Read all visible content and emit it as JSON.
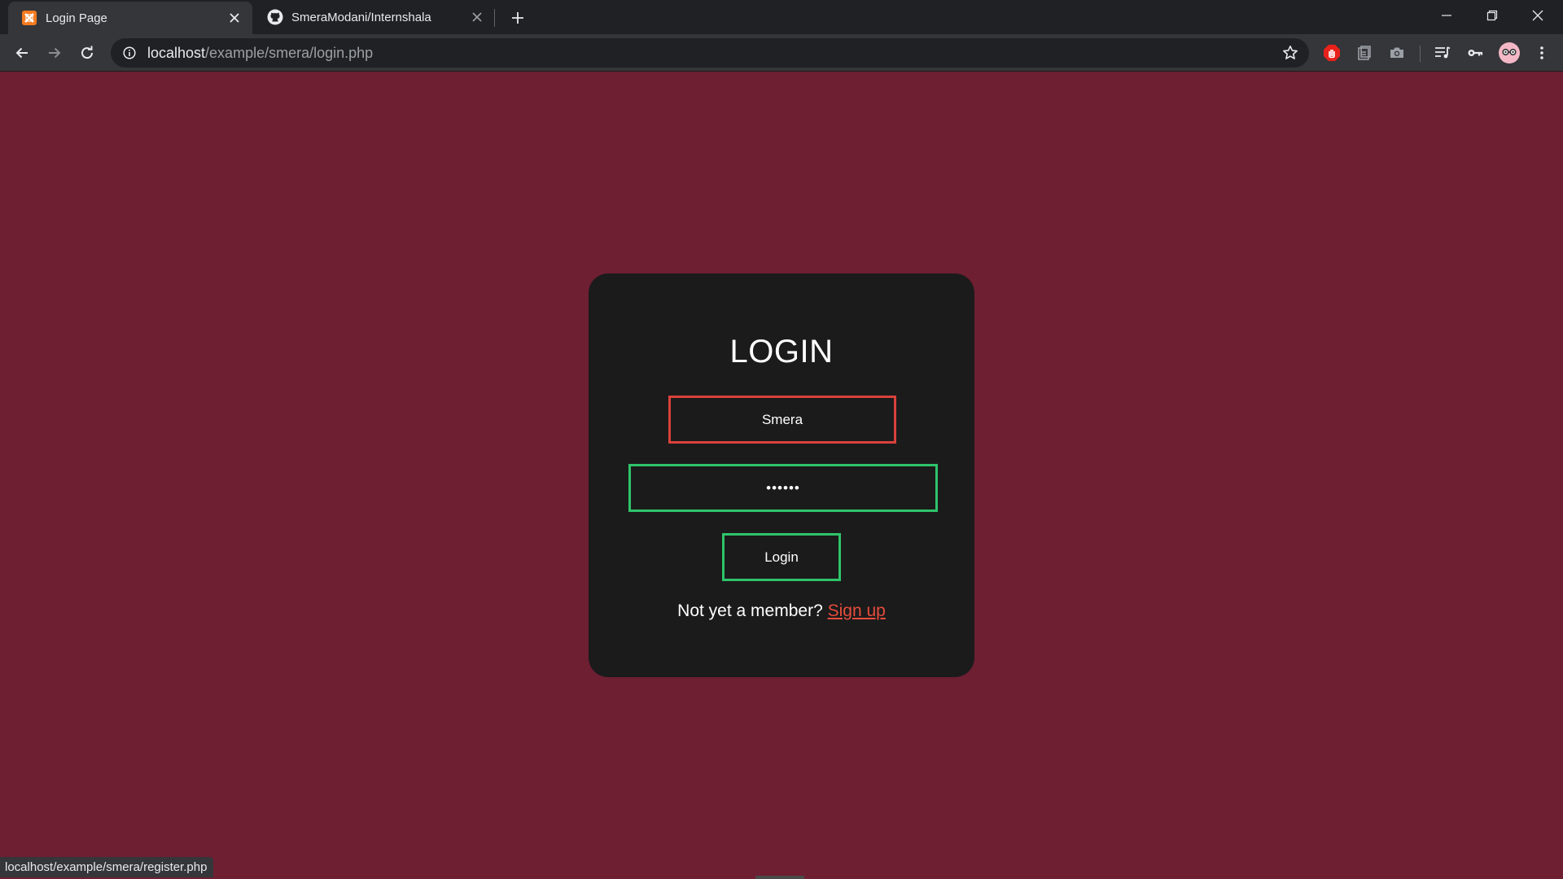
{
  "browser": {
    "tabs": [
      {
        "title": "Login Page",
        "icon": "xampp-icon",
        "active": true
      },
      {
        "title": "SmeraModani/Internshala",
        "icon": "github-icon",
        "active": false
      }
    ],
    "url_host": "localhost",
    "url_path": "/example/smera/login.php",
    "status_url": "localhost/example/smera/register.php",
    "extensions": [
      "adblock-icon",
      "clipboard-icon",
      "camera-icon",
      "media-queue-icon",
      "key-icon",
      "profile-avatar"
    ]
  },
  "login": {
    "title": "LOGIN",
    "username_value": "Smera",
    "password_value": "••••••",
    "button_label": "Login",
    "member_prompt": "Not yet a member?",
    "signup_label": "Sign up"
  },
  "colors": {
    "page_bg": "#6e1f32",
    "card_bg": "#1b1b1b",
    "error_border": "#d9413b",
    "success_border": "#2ec46b",
    "link": "#e74c3c"
  }
}
